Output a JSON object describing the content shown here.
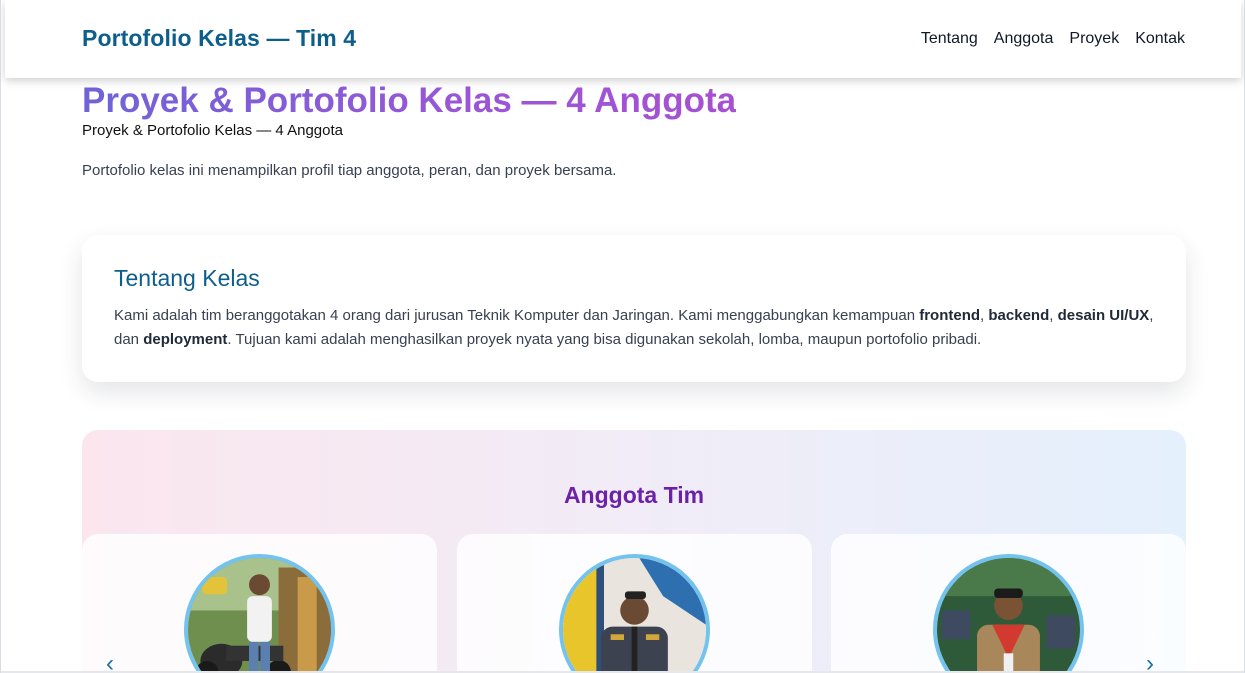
{
  "header": {
    "brand": "Portofolio Kelas — Tim 4",
    "nav": [
      "Tentang",
      "Anggota",
      "Proyek",
      "Kontak"
    ]
  },
  "hero": {
    "title": "Proyek & Portofolio Kelas — 4 Anggota",
    "subtitle": "Proyek & Portofolio Kelas — 4 Anggota",
    "lead": "Portofolio kelas ini menampilkan profil tiap anggota, peran, dan proyek bersama."
  },
  "about": {
    "title": "Tentang Kelas",
    "text_before": "Kami adalah tim beranggotakan 4 orang dari jurusan Teknik Komputer dan Jaringan. Kami menggabungkan kemampuan ",
    "skill_1": "frontend",
    "sep_1": ", ",
    "skill_2": "backend",
    "sep_2": ", ",
    "skill_3": "desain UI/UX",
    "sep_3": ", dan ",
    "skill_4": "deployment",
    "text_after": ". Tujuan kami adalah menghasilkan proyek nyata yang bisa digunakan sekolah, lomba, maupun portofolio pribadi."
  },
  "team": {
    "title": "Anggota Tim",
    "prev_icon": "chevron-left-icon",
    "next_icon": "chevron-right-icon",
    "prev_glyph": "‹",
    "next_glyph": "›"
  },
  "colors": {
    "brand": "#0e5e8c",
    "hero_gradient_start": "#6f63d8",
    "hero_gradient_end": "#a650d2",
    "team_title": "#6b21a8",
    "avatar_ring": "#74c3ee"
  }
}
